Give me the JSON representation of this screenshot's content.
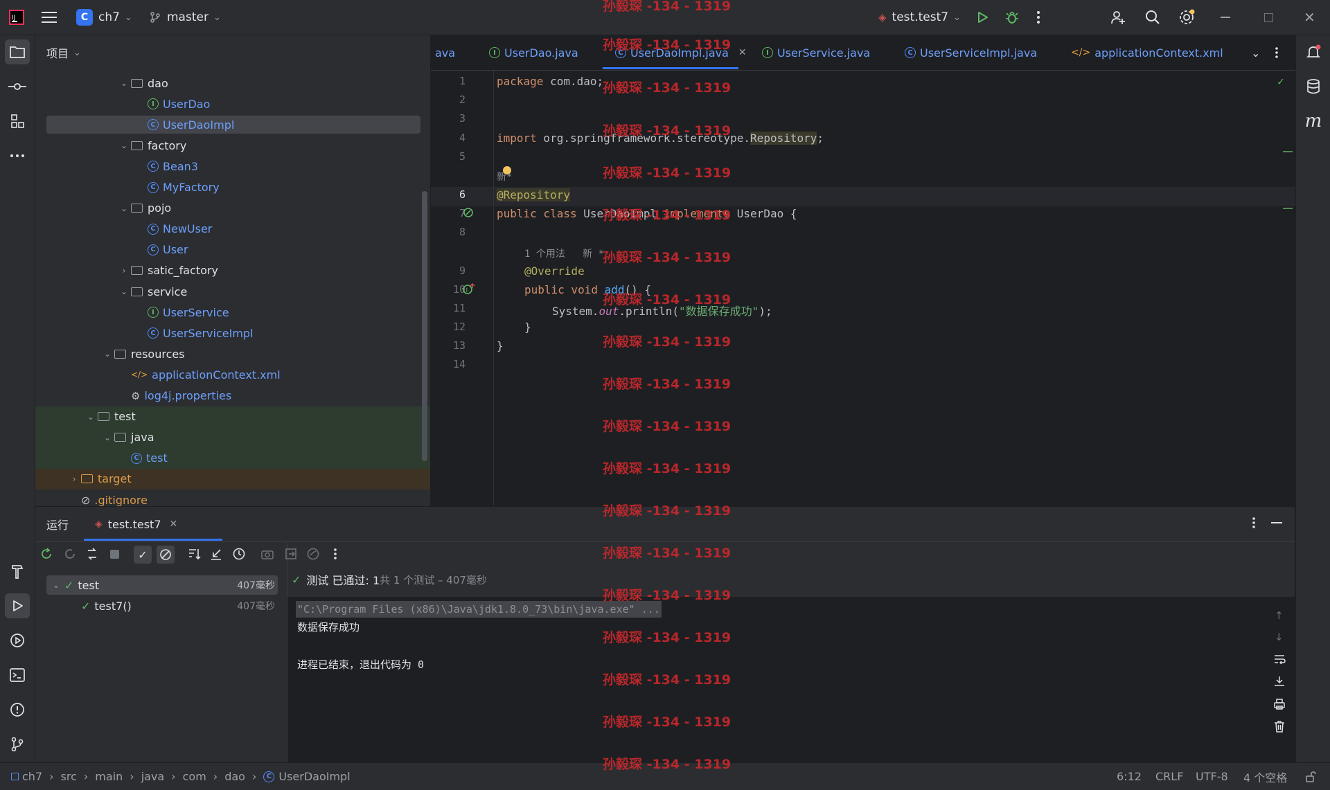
{
  "titlebar": {
    "project_badge": "C",
    "project": "ch7",
    "branch": "master",
    "run_config": "test.test7"
  },
  "project_panel": {
    "title": "项目",
    "tree": [
      {
        "label": "dao",
        "type": "folder",
        "depth": 3,
        "expanded": true
      },
      {
        "label": "UserDao",
        "type": "interface",
        "depth": 4
      },
      {
        "label": "UserDaoImpl",
        "type": "class",
        "depth": 4,
        "selected": true
      },
      {
        "label": "factory",
        "type": "folder",
        "depth": 3,
        "expanded": true
      },
      {
        "label": "Bean3",
        "type": "class",
        "depth": 4
      },
      {
        "label": "MyFactory",
        "type": "class",
        "depth": 4
      },
      {
        "label": "pojo",
        "type": "folder",
        "depth": 3,
        "expanded": true
      },
      {
        "label": "NewUser",
        "type": "class",
        "depth": 4
      },
      {
        "label": "User",
        "type": "class",
        "depth": 4
      },
      {
        "label": "satic_factory",
        "type": "folder",
        "depth": 3,
        "expanded": false
      },
      {
        "label": "service",
        "type": "folder",
        "depth": 3,
        "expanded": true
      },
      {
        "label": "UserService",
        "type": "interface",
        "depth": 4
      },
      {
        "label": "UserServiceImpl",
        "type": "class",
        "depth": 4
      },
      {
        "label": "resources",
        "type": "folder",
        "depth": 2,
        "expanded": true
      },
      {
        "label": "applicationContext.xml",
        "type": "xml",
        "depth": 3
      },
      {
        "label": "log4j.properties",
        "type": "props",
        "depth": 3
      },
      {
        "label": "test",
        "type": "folder",
        "depth": 1,
        "expanded": true
      },
      {
        "label": "java",
        "type": "folder",
        "depth": 2,
        "expanded": true
      },
      {
        "label": "test",
        "type": "class",
        "depth": 3
      },
      {
        "label": "target",
        "type": "folder",
        "depth": 0,
        "expanded": false
      },
      {
        "label": ".gitignore",
        "type": "ignore",
        "depth": 0
      }
    ]
  },
  "editor_tabs": [
    {
      "label": "ava",
      "icon": ""
    },
    {
      "label": "UserDao.java",
      "icon": "I"
    },
    {
      "label": "UserDaoImpl.java",
      "icon": "C",
      "active": true
    },
    {
      "label": "UserService.java",
      "icon": "I"
    },
    {
      "label": "UserServiceImpl.java",
      "icon": "C"
    },
    {
      "label": "applicationContext.xml",
      "icon": "xml"
    }
  ],
  "code": {
    "l1_kw": "package",
    "l1_rest": " com.dao;",
    "l4_kw": "import",
    "l4_rest": " org.springframework.stereotype.",
    "l4_cls": "Repository",
    "l4_end": ";",
    "hint1": "新*",
    "l6": "@Repository",
    "l7_kw": "public class",
    "l7_rest": " UserDaoImpl ",
    "l7_kw2": "implements",
    "l7_end": " UserDao {",
    "hint2": "1 个用法   新 *",
    "l9": "@Override",
    "l10_kw": "public void",
    "l10_fn": "add",
    "l10_end": "() {",
    "l11_a": "System.",
    "l11_out": "out",
    "l11_b": ".println(",
    "l11_str": "\"数据保存成功\"",
    "l11_c": ");",
    "l12": "}",
    "l13": "}",
    "line_numbers": [
      "1",
      "2",
      "3",
      "4",
      "5",
      "6",
      "7",
      "8",
      "9",
      "10",
      "11",
      "12",
      "13",
      "14"
    ]
  },
  "run_panel": {
    "title": "运行",
    "tab": "test.test7",
    "status": "测试 已通过: 1",
    "status_detail": "共 1 个测试 – 407毫秒",
    "tests": [
      {
        "label": "test",
        "time": "407毫秒"
      },
      {
        "label": "test7()",
        "time": "407毫秒"
      }
    ],
    "console": [
      "\"C:\\Program Files (x86)\\Java\\jdk1.8.0_73\\bin\\java.exe\" ...",
      "数据保存成功",
      "",
      "进程已结束，退出代码为 0"
    ]
  },
  "statusbar": {
    "breadcrumb": [
      "ch7",
      "src",
      "main",
      "java",
      "com",
      "dao",
      "UserDaoImpl"
    ],
    "position": "6:12",
    "line_sep": "CRLF",
    "encoding": "UTF-8",
    "indent": "4 个空格"
  },
  "watermark": "孙毅琛 -134 - 1319",
  "colors": {
    "accent": "#3574f0",
    "pass": "#5fb865",
    "watermark": "#c8282d"
  }
}
